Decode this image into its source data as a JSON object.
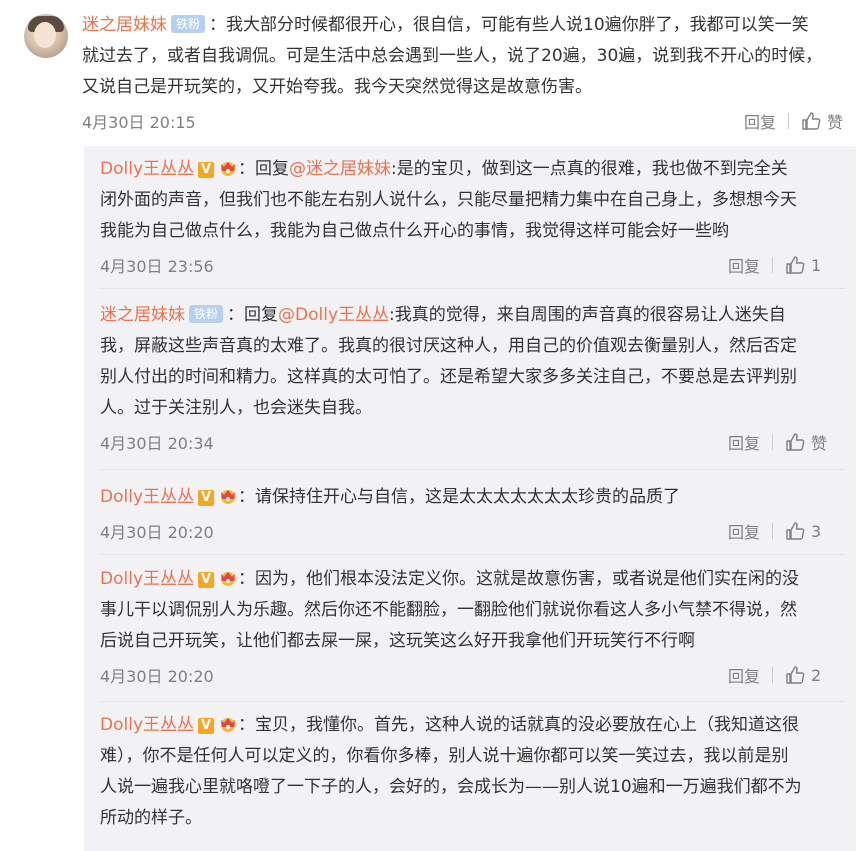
{
  "main": {
    "username": "迷之居妹妹",
    "badge": "铁粉",
    "lines": [
      "：我大部分时候都很开心，很自信，可能有些人说10遍你胖了，我都可以笑一笑",
      "就过去了，或者自我调侃。可是生活中总会遇到一些人，说了20遍，30遍，说到我不开心的时候，",
      "又说自己是开玩笑的，又开始夸我。我今天突然觉得这是故意伤害。"
    ],
    "time": "4月30日 20:15",
    "reply_label": "回复",
    "like_label": "赞"
  },
  "replies": [
    {
      "username": "Dolly王丛丛",
      "verified": "V",
      "prefix": "：回复",
      "mention": "@迷之居妹妹",
      "lines": [
        ":是的宝贝，做到这一点真的很难，我也做不到完全关",
        "闭外面的声音，但我们也不能左右别人说什么，只能尽量把精力集中在自己身上，多想想今天",
        "我能为自己做点什么，我能为自己做点什么开心的事情，我觉得这样可能会好一些哟"
      ],
      "time": "4月30日 23:56",
      "reply_label": "回复",
      "like_label": "1"
    },
    {
      "username": "迷之居妹妹",
      "badge": "铁粉",
      "prefix": "：回复",
      "mention": "@Dolly王丛丛",
      "lines": [
        ":我真的觉得，来自周围的声音真的很容易让人迷失自",
        "我，屏蔽这些声音真的太难了。我真的很讨厌这种人，用自己的价值观去衡量别人，然后否定",
        "别人付出的时间和精力。这样真的太可怕了。还是希望大家多多关注自己，不要总是去评判别",
        "人。过于关注别人，也会迷失自我。"
      ],
      "time": "4月30日 20:34",
      "reply_label": "回复",
      "like_label": "赞"
    },
    {
      "username": "Dolly王丛丛",
      "verified": "V",
      "lines": [
        "：请保持住开心与自信，这是太太太太太太太珍贵的品质了"
      ],
      "time": "4月30日 20:20",
      "reply_label": "回复",
      "like_label": "3"
    },
    {
      "username": "Dolly王丛丛",
      "verified": "V",
      "lines": [
        "：因为，他们根本没法定义你。这就是故意伤害，或者说是他们实在闲的没",
        "事儿干以调侃别人为乐趣。然后你还不能翻脸，一翻脸他们就说你看这人多小气禁不得说，然",
        "后说自己开玩笑，让他们都去屎一屎，这玩笑这么好开我拿他们开玩笑行不行啊"
      ],
      "time": "4月30日 20:20",
      "reply_label": "回复",
      "like_label": "2"
    },
    {
      "username": "Dolly王丛丛",
      "verified": "V",
      "lines": [
        "：宝贝，我懂你。首先，这种人说的话就真的没必要放在心上（我知道这很",
        "难），你不是任何人可以定义的，你看你多棒，别人说十遍你都可以笑一笑过去，我以前是别",
        "人说一遍我心里就咯噔了一下子的人，会好的，会成长为——别人说10遍和一万遍我们都不为",
        "所动的样子。"
      ]
    }
  ]
}
